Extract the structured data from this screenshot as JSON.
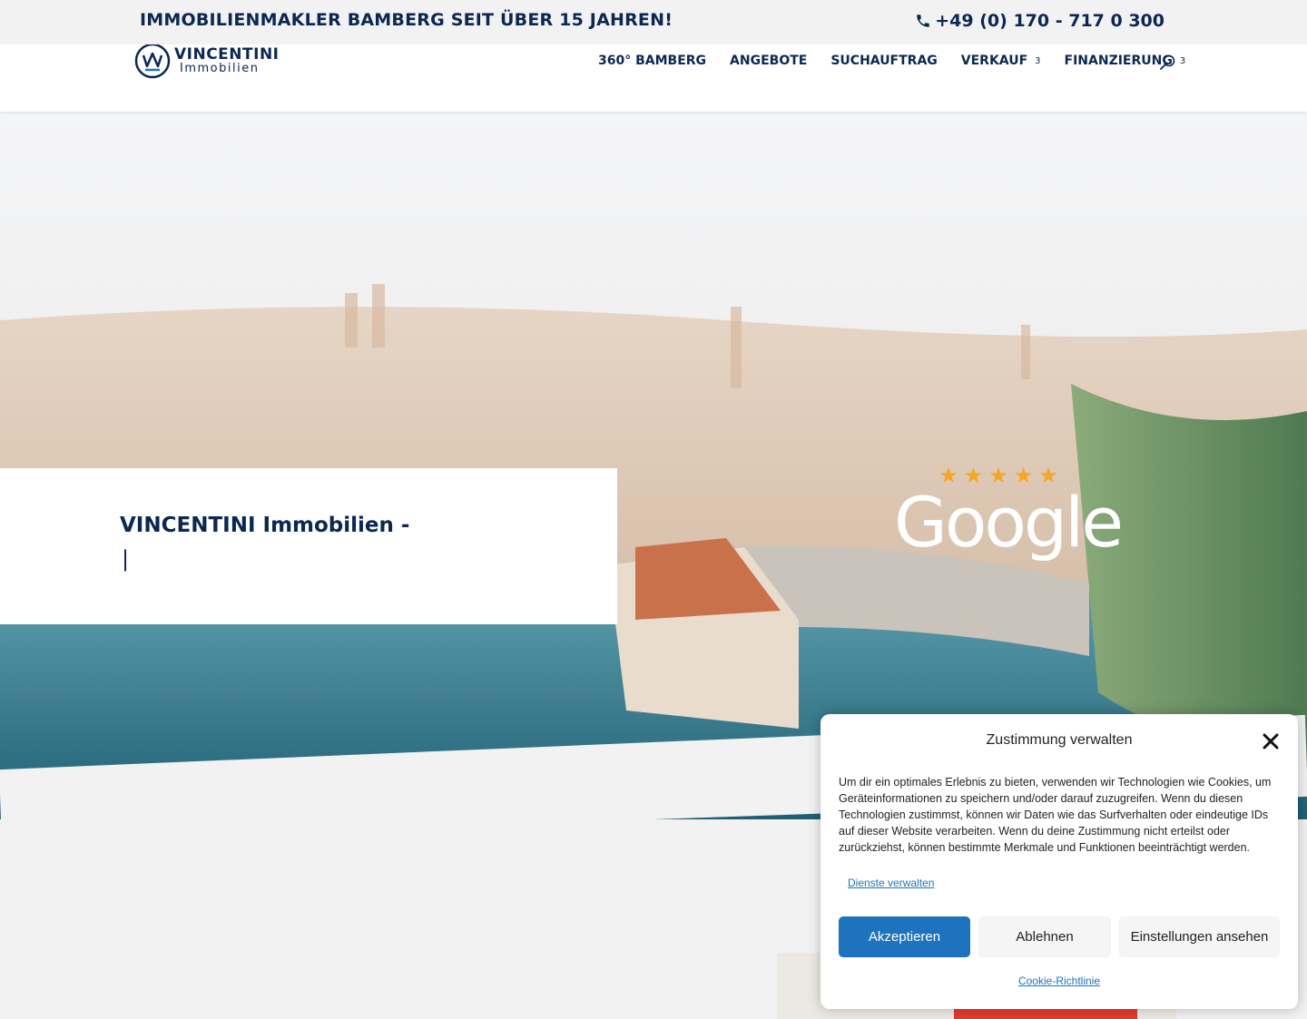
{
  "topbar": {
    "tagline": "IMMOBILIENMAKLER BAMBERG SEIT ÜBER 15 JAHREN!",
    "phone": "+49 (0) 170 - 717 0 300"
  },
  "header": {
    "logo_line1": "VINCENTINI",
    "logo_line2": "Immobilien",
    "nav": [
      {
        "label": "360° BAMBERG",
        "chevron": ""
      },
      {
        "label": "ANGEBOTE",
        "chevron": ""
      },
      {
        "label": "SUCHAUFTRAG",
        "chevron": ""
      },
      {
        "label": "VERKAUF",
        "chevron": "3"
      },
      {
        "label": "FINANZIERUNG",
        "chevron": "3"
      }
    ]
  },
  "hero": {
    "title": "VINCENTINI Immobilien -",
    "cursor": "|",
    "google_word": "Google",
    "stars": [
      "★",
      "★",
      "★",
      "★",
      "★"
    ]
  },
  "consent": {
    "title": "Zustimmung verwalten",
    "text": "Um dir ein optimales Erlebnis zu bieten, verwenden wir Technologien wie Cookies, um Geräteinformationen zu speichern und/oder darauf zuzugreifen. Wenn du diesen Technologien zustimmst, können wir Daten wie das Surfverhalten oder eindeutige IDs auf dieser Website verarbeiten. Wenn du deine Zustimmung nicht erteilst oder zurückziehst, können bestimmte Merkmale und Funktionen beeinträchtigt werden.",
    "manage_link": "Dienste verwalten",
    "accept": "Akzeptieren",
    "deny": "Ablehnen",
    "preferences": "Einstellungen ansehen",
    "policy_link": "Cookie-Richtlinie"
  },
  "colors": {
    "brand_navy": "#0b2752",
    "accent_blue": "#1e73be",
    "star_orange": "#f5a623"
  }
}
